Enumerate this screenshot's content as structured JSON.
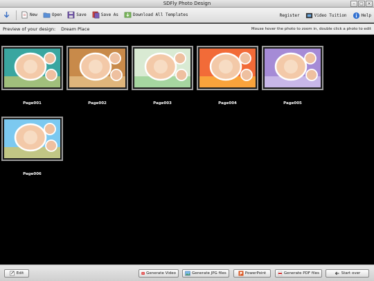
{
  "window": {
    "title": "SDFly Photo Design"
  },
  "toolbar": {
    "left": [
      {
        "name": "import-button",
        "icon": "down-arrow-icon",
        "label": ""
      },
      {
        "name": "new-button",
        "icon": "new-file-icon",
        "label": "New"
      },
      {
        "name": "open-button",
        "icon": "open-folder-icon",
        "label": "Open"
      },
      {
        "name": "save-button",
        "icon": "floppy-disk-icon",
        "label": "Save"
      },
      {
        "name": "save-as-button",
        "icon": "save-as-icon",
        "label": "Save As"
      },
      {
        "name": "download-templates-button",
        "icon": "download-icon",
        "label": "Download All Templates"
      }
    ],
    "right": [
      {
        "name": "register-button",
        "icon": "",
        "label": "Register"
      },
      {
        "name": "video-tuition-button",
        "icon": "film-icon",
        "label": "Video Tuition"
      },
      {
        "name": "help-button",
        "icon": "info-icon",
        "label": "Help"
      }
    ]
  },
  "infobar": {
    "label": "Preview of your design:",
    "design_name": "Dream Place",
    "hint": "Mouse hover the photo to zoom in, double click a photo to edit"
  },
  "pages": [
    {
      "label": "Page001",
      "bg": "#3aa6a0",
      "accent": "#f4d35e",
      "frame": "#ffffff"
    },
    {
      "label": "Page002",
      "bg": "#c88a4a",
      "accent": "#f3d9a4",
      "frame": "#ffffff"
    },
    {
      "label": "Page003",
      "bg": "#d9ead3",
      "accent": "#7cc576",
      "frame": "#ffffff"
    },
    {
      "label": "Page004",
      "bg": "#f26b38",
      "accent": "#ffd23f",
      "frame": "#ffffff"
    },
    {
      "label": "Page005",
      "bg": "#a58bd6",
      "accent": "#e6dcf7",
      "frame": "#ffffff"
    },
    {
      "label": "Page006",
      "bg": "#7cc9f0",
      "accent": "#f9c22e",
      "frame": "#ffffff"
    }
  ],
  "bottombar": {
    "edit": "Edit",
    "generate_video": "Generate Video",
    "generate_jpg": "Generate JPG files",
    "powerpoint": "PowerPoint",
    "generate_pdf": "Generate PDF files",
    "start_over": "Start over"
  }
}
